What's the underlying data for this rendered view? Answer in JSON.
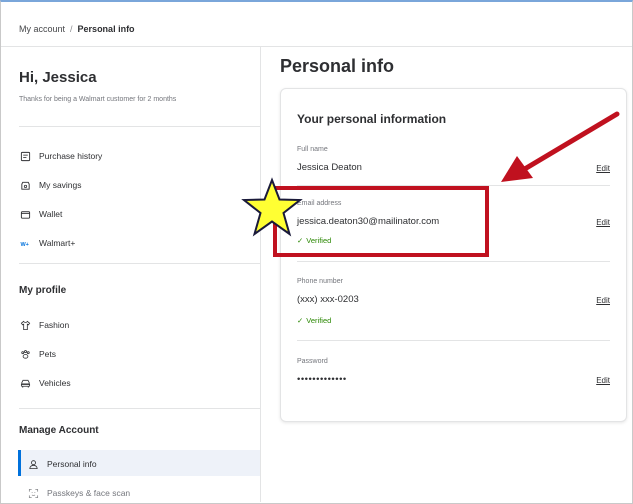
{
  "breadcrumb": {
    "parent": "My account",
    "separator": "/",
    "current": "Personal info"
  },
  "sidebar": {
    "greeting": "Hi, Jessica",
    "greeting_sub": "Thanks for being a Walmart customer for 2 months",
    "items": [
      {
        "label": "Purchase history",
        "icon": "receipt-icon"
      },
      {
        "label": "My savings",
        "icon": "savings-icon"
      },
      {
        "label": "Wallet",
        "icon": "wallet-icon"
      },
      {
        "label": "Walmart+",
        "icon": "walmart-plus-icon"
      }
    ],
    "profile_title": "My profile",
    "profile_items": [
      {
        "label": "Fashion",
        "icon": "shirt-icon"
      },
      {
        "label": "Pets",
        "icon": "paw-icon"
      },
      {
        "label": "Vehicles",
        "icon": "car-icon"
      }
    ],
    "manage_title": "Manage Account",
    "manage_items": [
      {
        "label": "Personal info",
        "icon": "person-icon",
        "active": true
      },
      {
        "label": "Passkeys & face scan",
        "icon": "face-scan-icon"
      }
    ]
  },
  "main": {
    "title": "Personal info",
    "card_title": "Your personal information",
    "fields": {
      "full_name": {
        "label": "Full name",
        "value": "Jessica Deaton",
        "edit": "Edit"
      },
      "email": {
        "label": "Email address",
        "value": "jessica.deaton30@mailinator.com",
        "verified": "Verified",
        "edit": "Edit"
      },
      "phone": {
        "label": "Phone number",
        "value": "(xxx) xxx-0203",
        "verified": "Verified",
        "edit": "Edit"
      },
      "password": {
        "label": "Password",
        "value": "•••••••••••••",
        "edit": "Edit"
      }
    }
  },
  "annotations": {
    "highlight_color": "#c0111f",
    "star_color": "#ffff33",
    "arrow_color": "#c0111f"
  },
  "colors": {
    "accent": "#0071dc",
    "verified": "#2a8703"
  }
}
